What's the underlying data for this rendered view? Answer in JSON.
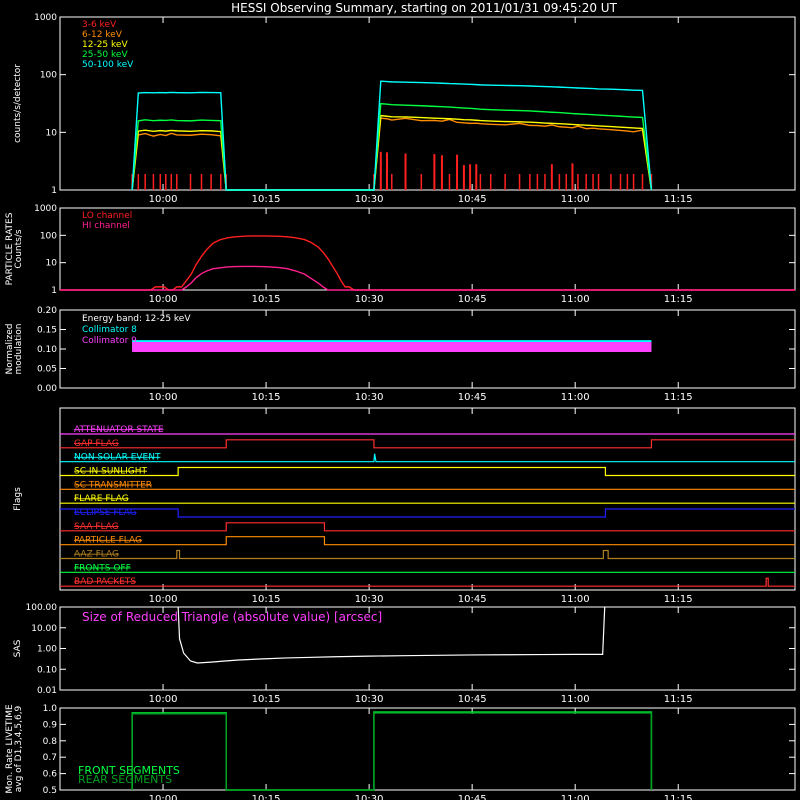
{
  "title": "HESSI Observing Summary, starting on 2011/01/31 09:45:20 UT",
  "time_ticks": [
    "10:00",
    "10:15",
    "10:30",
    "10:45",
    "11:00",
    "11:15"
  ],
  "time_tick_minutes": [
    15,
    30,
    45,
    60,
    75,
    90
  ],
  "time_range_minutes": [
    0,
    107
  ],
  "chart_data": [
    {
      "type": "line",
      "name": "count-rates",
      "ylabel": "counts/s/detector",
      "ylim": [
        1,
        1000
      ],
      "yscale": "log",
      "y_tick_labels": [
        "1",
        "10",
        "100",
        "1000"
      ],
      "legend": "top-left",
      "series": [
        {
          "name": "3-6 keV",
          "color": "#ff2020",
          "x": [
            10.5,
            11.4,
            12.4,
            13.6,
            14.6,
            15.4,
            16.2,
            17.0,
            19.0,
            20.6,
            22.0,
            23.4,
            24.2,
            45.7,
            46.7,
            47.6,
            48.3,
            50.3,
            52.6,
            54.5,
            55.6,
            56.7,
            57.8,
            58.8,
            59.7,
            60.6,
            61.2,
            62.7,
            64.8,
            66.9,
            68.4,
            69.5,
            70.6,
            71.6,
            72.7,
            73.7,
            74.6,
            75.4,
            76.6,
            77.6,
            78.4,
            80.2,
            81.6,
            82.6,
            83.5,
            84.8,
            86.1
          ],
          "y": [
            1,
            1,
            1,
            1,
            1,
            1,
            1,
            1,
            1,
            1,
            1,
            1,
            1,
            1,
            4.6,
            4.5,
            1,
            4.3,
            1,
            4.2,
            4,
            1,
            4.1,
            2.7,
            2.8,
            2.8,
            1,
            1,
            1,
            1,
            1,
            1,
            1,
            2.8,
            1,
            1,
            2.9,
            1,
            1,
            1,
            1,
            1,
            1,
            1,
            1,
            1,
            1
          ]
        },
        {
          "name": "6-12 keV",
          "color": "#ff8c00",
          "x": [
            10.5,
            11.4,
            12.4,
            13.6,
            14.6,
            15.4,
            16.2,
            17.0,
            19.0,
            20.6,
            22.0,
            23.4,
            24.2,
            45.7,
            46.7,
            47.6,
            48.3,
            50.3,
            52.6,
            54.5,
            55.6,
            56.7,
            57.8,
            58.8,
            59.7,
            60.6,
            61.2,
            62.7,
            64.8,
            66.9,
            68.4,
            69.5,
            70.6,
            71.6,
            72.7,
            73.7,
            74.6,
            75.4,
            76.6,
            77.6,
            78.4,
            80.2,
            81.6,
            82.6,
            83.5,
            84.8,
            86.1
          ],
          "y": [
            1,
            9,
            9.5,
            8.6,
            9.2,
            8.8,
            9.6,
            9.0,
            8.9,
            9.3,
            9.1,
            8.7,
            1,
            1,
            17.6,
            17.2,
            16.3,
            17.5,
            15.9,
            16.1,
            15.6,
            16.7,
            14.9,
            14.6,
            14.3,
            14.4,
            14.1,
            13.8,
            13.5,
            14.3,
            13.2,
            13.1,
            12.8,
            13.4,
            12.5,
            12.3,
            12.0,
            12.8,
            11.6,
            11.8,
            11.5,
            11.1,
            10.8,
            10.5,
            10.2,
            11.0,
            1
          ]
        },
        {
          "name": "12-25 keV",
          "color": "#ffff00",
          "x": [
            10.5,
            11.4,
            12.4,
            13.6,
            14.6,
            15.4,
            16.2,
            17.0,
            19.0,
            20.6,
            22.0,
            23.4,
            24.2,
            45.7,
            46.7,
            47.6,
            48.3,
            50.3,
            52.6,
            54.5,
            55.6,
            56.7,
            57.8,
            58.8,
            59.7,
            60.6,
            61.2,
            62.7,
            64.8,
            66.9,
            68.4,
            69.5,
            70.6,
            71.6,
            72.7,
            73.7,
            74.6,
            75.4,
            76.6,
            77.6,
            78.4,
            80.2,
            81.6,
            82.6,
            83.5,
            84.8,
            86.1
          ],
          "y": [
            1,
            10.5,
            10.9,
            10.4,
            10.7,
            10.5,
            10.8,
            10.6,
            10.4,
            10.7,
            10.6,
            10.3,
            1,
            1,
            19.5,
            19.0,
            18.6,
            18.5,
            18.0,
            17.6,
            17.4,
            17.2,
            16.9,
            16.6,
            16.5,
            16.2,
            16.0,
            15.7,
            15.4,
            15.2,
            15.0,
            14.8,
            14.5,
            14.3,
            14.1,
            13.9,
            13.7,
            13.5,
            13.3,
            13.1,
            12.9,
            12.6,
            12.3,
            12.1,
            11.9,
            11.7,
            1
          ]
        },
        {
          "name": "25-50 keV",
          "color": "#00ff40",
          "x": [
            10.5,
            11.4,
            12.4,
            13.6,
            14.6,
            15.4,
            16.2,
            17.0,
            19.0,
            20.6,
            22.0,
            23.4,
            24.2,
            45.7,
            46.7,
            47.6,
            48.3,
            50.3,
            52.6,
            54.5,
            55.6,
            56.7,
            57.8,
            58.8,
            59.7,
            60.6,
            61.2,
            62.7,
            64.8,
            66.9,
            68.4,
            69.5,
            70.6,
            71.6,
            72.7,
            73.7,
            74.6,
            75.4,
            76.6,
            77.6,
            78.4,
            80.2,
            81.6,
            82.6,
            83.5,
            84.8,
            86.1
          ],
          "y": [
            1,
            15.8,
            16.5,
            15.9,
            16.2,
            16.1,
            16.4,
            16.0,
            15.8,
            16.3,
            16.1,
            15.9,
            1,
            1,
            31.5,
            30.8,
            30.1,
            29.6,
            28.9,
            28.2,
            27.9,
            27.4,
            26.9,
            26.4,
            26.1,
            25.6,
            25.2,
            24.7,
            24.2,
            23.9,
            23.5,
            23.1,
            22.7,
            22.3,
            22.0,
            21.6,
            21.2,
            20.9,
            20.5,
            20.2,
            19.9,
            19.4,
            19.0,
            18.7,
            18.4,
            18.1,
            1
          ]
        },
        {
          "name": "50-100 keV",
          "color": "#00ffff",
          "x": [
            10.5,
            11.4,
            12.4,
            13.6,
            14.6,
            15.4,
            16.2,
            17.0,
            19.0,
            20.6,
            22.0,
            23.4,
            24.2,
            45.7,
            46.7,
            47.6,
            48.3,
            50.3,
            52.6,
            54.5,
            55.6,
            56.7,
            57.8,
            58.8,
            59.7,
            60.6,
            61.2,
            62.7,
            64.8,
            66.9,
            68.4,
            69.5,
            70.6,
            71.6,
            72.7,
            73.7,
            74.6,
            75.4,
            76.6,
            77.6,
            78.4,
            80.2,
            81.6,
            82.6,
            83.5,
            84.8,
            86.1
          ],
          "y": [
            1,
            48,
            49,
            48.5,
            49,
            48.6,
            49.2,
            48.8,
            48.4,
            49.1,
            48.9,
            48.7,
            1,
            1,
            77,
            76,
            75,
            74,
            73,
            72,
            71,
            70,
            69.5,
            68.7,
            68,
            67.2,
            66.5,
            65.8,
            65,
            64.3,
            63.6,
            62.9,
            62.2,
            61.5,
            60.8,
            60.1,
            59.4,
            58.7,
            58,
            57.3,
            56.6,
            55.9,
            55.2,
            54.5,
            53.9,
            53.2,
            1
          ]
        }
      ]
    },
    {
      "type": "line",
      "name": "particle-rates",
      "ylabel": "PARTICLE RATES Counts/s",
      "ylim": [
        1,
        1000
      ],
      "yscale": "log",
      "y_tick_labels": [
        "1",
        "10",
        "100",
        "1000"
      ],
      "legend": "top-left",
      "series": [
        {
          "name": "LO channel",
          "color": "#ff2020",
          "x": [
            0,
            9,
            9.6,
            10.7,
            11.3,
            11.9,
            12.6,
            13.2,
            13.9,
            14.5,
            15.2,
            15.8,
            16.4,
            17.0,
            17.7,
            18.4,
            19.1,
            19.8,
            20.6,
            21.4,
            22.3,
            23.3,
            24.4,
            25.5,
            26.8,
            27.9,
            29.3,
            30.6,
            31.9,
            33.1,
            34.3,
            35.6,
            36.6,
            37.6,
            38.3,
            39.0,
            39.6,
            40.3,
            40.9,
            41.5,
            42.1,
            42.8,
            43.4,
            44.0,
            107
          ],
          "y": [
            1,
            1,
            1,
            1,
            1,
            1,
            1,
            1,
            1.3,
            1.3,
            1.3,
            1,
            1,
            1.3,
            1.3,
            2.2,
            3.8,
            8.4,
            17,
            31,
            52,
            69,
            81,
            88,
            93,
            95,
            95,
            94,
            92,
            88,
            81,
            70,
            54,
            37,
            24,
            14,
            8,
            4.2,
            2.2,
            1.3,
            1.3,
            1,
            1,
            1,
            1
          ]
        },
        {
          "name": "HI channel",
          "color": "#ff2090",
          "x": [
            0,
            17.7,
            18.4,
            19.1,
            19.8,
            20.6,
            21.4,
            22.3,
            23.3,
            24.4,
            25.5,
            26.8,
            27.9,
            29.3,
            30.6,
            31.9,
            33.1,
            34.3,
            35.6,
            36.6,
            37.6,
            38.3,
            39.0,
            39.6,
            40.3,
            40.9,
            41.5,
            107
          ],
          "y": [
            1,
            1,
            1.3,
            1.8,
            2.8,
            4,
            5,
            6,
            6.5,
            7,
            7.2,
            7.3,
            7.3,
            7.2,
            7,
            6.6,
            6,
            5,
            3.8,
            2.6,
            1.8,
            1.3,
            1,
            1,
            1,
            1,
            1,
            1
          ]
        }
      ]
    },
    {
      "type": "line",
      "name": "modulation",
      "ylabel": "Normalized modulation",
      "ylim": [
        0,
        0.2
      ],
      "y_tick_labels": [
        "0.00",
        "0.05",
        "0.10",
        "0.15",
        "0.20"
      ],
      "legend": "top-left",
      "annotation": "Energy band: 12-25 keV",
      "series": [
        {
          "name": "Collimator 8",
          "color": "#00ffff",
          "x": [
            10.5,
            24.2,
            45.7,
            86.1
          ],
          "y": [
            0.11,
            0.11,
            0.11,
            0.11
          ]
        },
        {
          "name": "Collimator 9",
          "color": "#ff40ff",
          "x": [
            10.5,
            24.2,
            45.7,
            86.1
          ],
          "y": [
            0.105,
            0.105,
            0.105,
            0.105
          ]
        }
      ]
    },
    {
      "type": "line",
      "name": "flags",
      "ylabel": "Flags",
      "series": [
        {
          "name": "ATTENUATOR STATE",
          "color": "#ff40ff",
          "x": [
            0,
            107
          ],
          "y": [
            0,
            0
          ]
        },
        {
          "name": "GAP FLAG",
          "color": "#ff3030",
          "x": [
            0,
            24.2,
            24.2,
            45.7,
            45.7,
            86.1,
            86.1,
            107
          ],
          "y": [
            0,
            0,
            1,
            1,
            0,
            0,
            1,
            1
          ]
        },
        {
          "name": "NON SOLAR EVENT",
          "color": "#00ffff",
          "x": [
            0,
            45.7,
            45.8,
            46,
            107
          ],
          "y": [
            0,
            0,
            1,
            0,
            0
          ]
        },
        {
          "name": "SC IN SUNLIGHT",
          "color": "#ffff00",
          "x": [
            0,
            17.2,
            17.2,
            79.4,
            79.4,
            107
          ],
          "y": [
            0,
            0,
            1,
            1,
            0,
            0
          ]
        },
        {
          "name": "SC TRANSMITTER",
          "color": "#ff8c00",
          "x": [
            0,
            107
          ],
          "y": [
            0,
            0
          ]
        },
        {
          "name": "FLARE FLAG",
          "color": "#ffff00",
          "x": [
            0,
            107
          ],
          "y": [
            0,
            0
          ]
        },
        {
          "name": "ECLIPSE FLAG",
          "color": "#2020ff",
          "x": [
            0,
            17.2,
            17.2,
            79.4,
            79.4,
            107
          ],
          "y": [
            1,
            1,
            0,
            0,
            1,
            1
          ]
        },
        {
          "name": "SAA FLAG",
          "color": "#ff3030",
          "x": [
            0,
            24.2,
            24.2,
            38.5,
            38.5,
            107
          ],
          "y": [
            0,
            0,
            1,
            1,
            0,
            0
          ]
        },
        {
          "name": "PARTICLE FLAG",
          "color": "#ff8c00",
          "x": [
            0,
            24.2,
            24.2,
            38.5,
            38.5,
            107
          ],
          "y": [
            0,
            0,
            1,
            1,
            0,
            0
          ]
        },
        {
          "name": "AAZ FLAG",
          "color": "#b08020",
          "x": [
            0,
            17.0,
            17.0,
            17.4,
            17.4,
            79.1,
            79.1,
            79.8,
            79.8,
            107
          ],
          "y": [
            0,
            0,
            1,
            1,
            0,
            0,
            1,
            1,
            0,
            0
          ]
        },
        {
          "name": "FRONTS OFF",
          "color": "#00ff40",
          "x": [
            0,
            107
          ],
          "y": [
            0,
            0
          ]
        },
        {
          "name": "BAD PACKETS",
          "color": "#ff3030",
          "x": [
            0,
            102.8,
            102.8,
            103.1,
            103.1,
            107
          ],
          "y": [
            0,
            0,
            1,
            1,
            0,
            0
          ]
        }
      ]
    },
    {
      "type": "line",
      "name": "sas",
      "ylabel": "SAS",
      "title": "Size of Reduced Triangle (absolute value) [arcsec]",
      "ylim": [
        0.01,
        100
      ],
      "yscale": "log",
      "y_tick_labels": [
        "0.01",
        "0.10",
        "1.00",
        "10.00",
        "100.00"
      ],
      "series": [
        {
          "name": "",
          "color": "#ffffff",
          "x": [
            17.2,
            17.4,
            18,
            19,
            20,
            22,
            24,
            26,
            28,
            30,
            33,
            36,
            40,
            45,
            50,
            55,
            60,
            65,
            70,
            75,
            79,
            79.3
          ],
          "y": [
            100,
            3,
            0.6,
            0.25,
            0.2,
            0.22,
            0.25,
            0.28,
            0.3,
            0.32,
            0.35,
            0.37,
            0.4,
            0.43,
            0.45,
            0.47,
            0.49,
            0.5,
            0.51,
            0.52,
            0.52,
            100
          ]
        }
      ]
    },
    {
      "type": "line",
      "name": "livetime",
      "ylabel": "Mon. Rate LIVETIME avg of D1,3,4,5,6,9",
      "ylim": [
        0.5,
        1.0
      ],
      "y_tick_labels": [
        "0.5",
        "0.6",
        "0.7",
        "0.8",
        "0.9",
        "1.0"
      ],
      "legend": "bottom-left",
      "series": [
        {
          "name": "FRONT SEGMENTS",
          "color": "#00ff40",
          "x": [
            10.5,
            10.5,
            24.2,
            24.2,
            45.7,
            45.7,
            86.1,
            86.1
          ],
          "y": [
            0.5,
            0.97,
            0.97,
            0.5,
            0.5,
            0.975,
            0.975,
            0.5
          ]
        },
        {
          "name": "REAR SEGMENTS",
          "color": "#00a020",
          "x": [
            10.5,
            10.5,
            24.2,
            24.2,
            45.7,
            45.7,
            86.1,
            86.1
          ],
          "y": [
            0.5,
            0.965,
            0.965,
            0.5,
            0.5,
            0.97,
            0.97,
            0.5
          ]
        }
      ]
    }
  ]
}
